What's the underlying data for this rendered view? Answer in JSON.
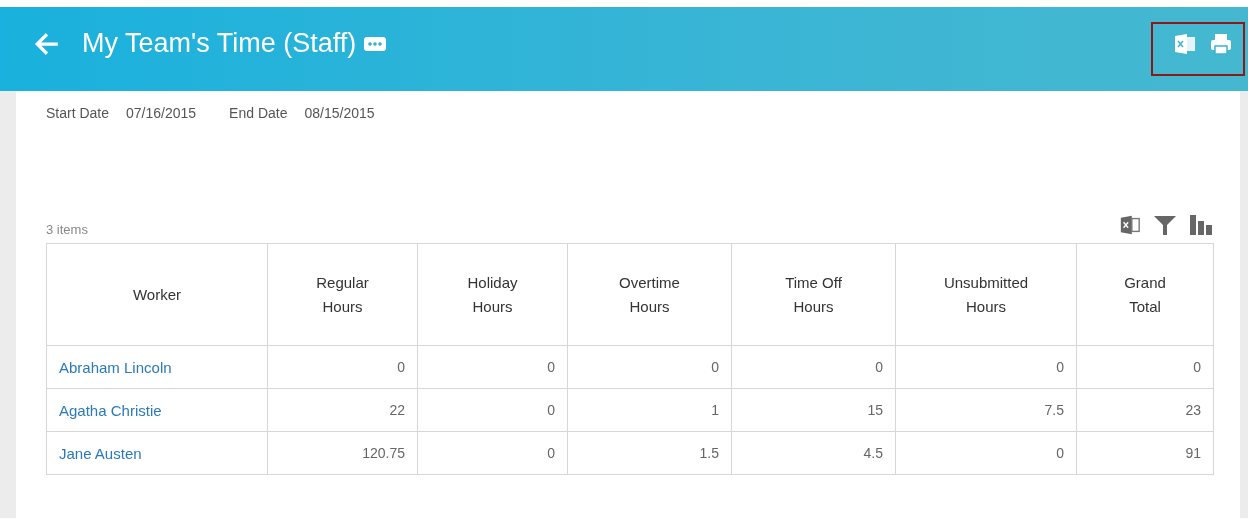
{
  "header": {
    "title": "My Team's Time (Staff)"
  },
  "dates": [
    {
      "label": "Start Date",
      "value": "07/16/2015"
    },
    {
      "label": "End Date",
      "value": "08/15/2015"
    }
  ],
  "table": {
    "count": "3 items",
    "columns": [
      "Worker",
      "Regular\nHours",
      "Holiday\nHours",
      "Overtime\nHours",
      "Time Off\nHours",
      "Unsubmitted\nHours",
      "Grand\nTotal"
    ],
    "rows": [
      [
        "Abraham Lincoln",
        "0",
        "0",
        "0",
        "0",
        "0",
        "0"
      ],
      [
        "Agatha Christie",
        "22",
        "0",
        "1",
        "15",
        "7.5",
        "23"
      ],
      [
        "Jane Austen",
        "120.75",
        "0",
        "1.5",
        "4.5",
        "0",
        "91"
      ]
    ]
  }
}
